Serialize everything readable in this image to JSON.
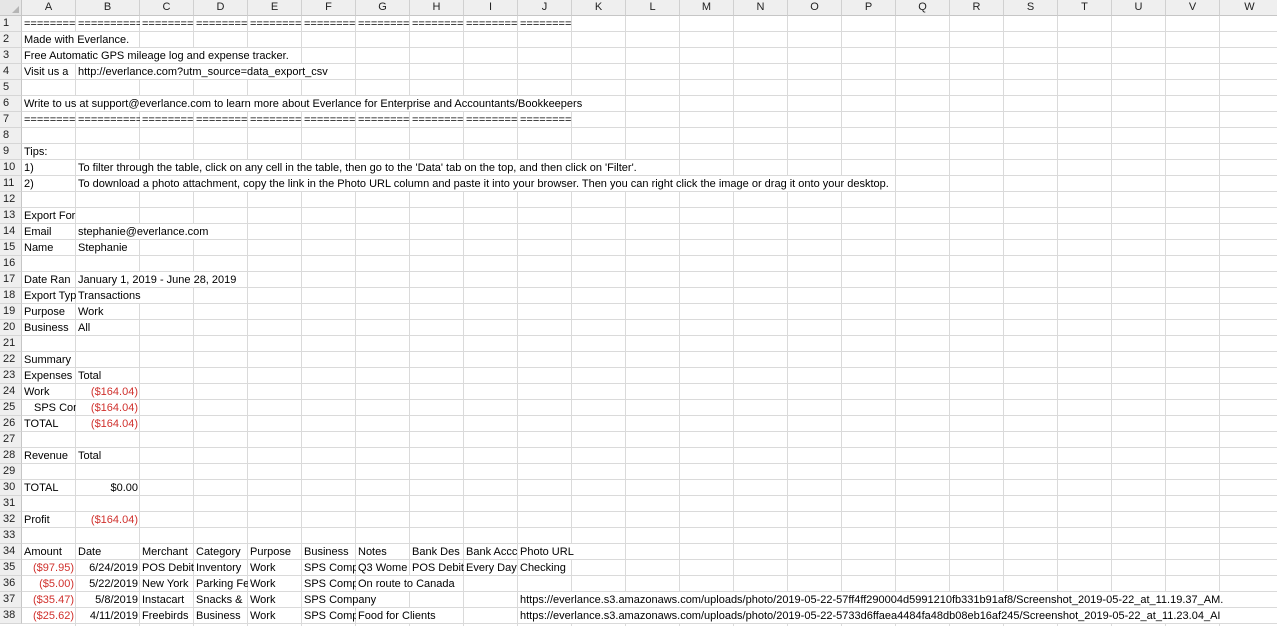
{
  "columns": [
    "A",
    "B",
    "C",
    "D",
    "E",
    "F",
    "G",
    "H",
    "I",
    "J",
    "K",
    "L",
    "M",
    "N",
    "O",
    "P",
    "Q",
    "R",
    "S",
    "T",
    "U",
    "V",
    "W"
  ],
  "rows": [
    "1",
    "2",
    "3",
    "4",
    "5",
    "6",
    "7",
    "8",
    "9",
    "10",
    "11",
    "12",
    "13",
    "14",
    "15",
    "16",
    "17",
    "18",
    "19",
    "20",
    "21",
    "22",
    "23",
    "24",
    "25",
    "26",
    "27",
    "28",
    "29",
    "30",
    "31",
    "32",
    "33",
    "34",
    "35",
    "36",
    "37",
    "38"
  ],
  "sep1": [
    "=========",
    "==========",
    "=========",
    "=========",
    "=========",
    "=========",
    "=========",
    "=========",
    "=========",
    "=========="
  ],
  "sep7": [
    "=========",
    "==========",
    "=========",
    "=========",
    "=========",
    "=========",
    "=========",
    "=========",
    "=========",
    "=========="
  ],
  "header_lines": {
    "made_with": "Made with Everlance.",
    "tagline": "Free Automatic GPS mileage log and expense tracker.",
    "visit": "Visit us a",
    "visit_url": "http://everlance.com?utm_source=data_export_csv",
    "write": "Write to us at support@everlance.com to learn more about Everlance for Enterprise and Accountants/Bookkeepers"
  },
  "tips": {
    "title": "Tips:",
    "n1": "1)",
    "t1": "To filter through the table, click on any cell in the table, then go to the 'Data' tab on the top, and then click on 'Filter'.",
    "n2": "2)",
    "t2": "To download a photo attachment, copy the link in the Photo URL column and paste it into your browser. Then you can right click the image or drag it onto your desktop."
  },
  "export": {
    "title": "Export For",
    "email_label": "Email",
    "email": "stephanie@everlance.com",
    "name_label": "Name",
    "name": "Stephanie",
    "date_label": "Date Ran",
    "date": "January  1, 2019 - June 28, 2019",
    "type_label": "Export Typ",
    "type": "Transactions",
    "purpose_label": "Purpose",
    "purpose": "Work",
    "business_label": "Business",
    "business": "All"
  },
  "summary": {
    "title": "Summary",
    "expenses_label": "Expenses",
    "total_header": "Total",
    "work_label": "Work",
    "work_total": "($164.04)",
    "sps_label": "SPS Con",
    "sps_total": "($164.04)",
    "total_label": "TOTAL",
    "total": "($164.04)",
    "revenue_label": "Revenue",
    "revenue_total_header": "Total",
    "revenue_total_label": "TOTAL",
    "revenue_total": "$0.00",
    "profit_label": "Profit",
    "profit": "($164.04)"
  },
  "table": {
    "headers": [
      "Amount",
      "Date",
      "Merchant",
      "Category",
      "Purpose",
      "Business",
      "Notes",
      "Bank Des",
      "Bank Accc",
      "Photo URL"
    ],
    "rows": [
      {
        "amount": "($97.95)",
        "date": "6/24/2019",
        "merchant": "POS Debit",
        "category": "Inventory",
        "purpose": "Work",
        "business": "SPS Comp",
        "notes": "Q3 Wome",
        "bank_desc": "POS Debit",
        "bank_acct": "Every Day",
        "photo": "Checking"
      },
      {
        "amount": "($5.00)",
        "date": "5/22/2019",
        "merchant": "New York",
        "category": "Parking Fe",
        "purpose": "Work",
        "business": "SPS Comp",
        "notes": "On route to Canada",
        "bank_desc": "",
        "bank_acct": "",
        "photo": ""
      },
      {
        "amount": "($35.47)",
        "date": "5/8/2019",
        "merchant": "Instacart",
        "category": "Snacks &",
        "purpose": "Work",
        "business": "SPS Company",
        "notes": "",
        "bank_desc": "",
        "bank_acct": "",
        "photo": "https://everlance.s3.amazonaws.com/uploads/photo/2019-05-22-57ff4ff290004d5991210fb331b91af8/Screenshot_2019-05-22_at_11.19.37_AM."
      },
      {
        "amount": "($25.62)",
        "date": "4/11/2019",
        "merchant": "Freebirds",
        "category": "Business",
        "purpose": "Work",
        "business": "SPS Comp",
        "notes": "Food for Clients",
        "bank_desc": "",
        "bank_acct": "",
        "photo": "https://everlance.s3.amazonaws.com/uploads/photo/2019-05-22-5733d6ffaea4484fa48db08eb16af245/Screenshot_2019-05-22_at_11.23.04_AI"
      }
    ]
  },
  "colors": {
    "negative": "#d0312d",
    "header_bg": "#efefef",
    "grid": "#dadada"
  }
}
